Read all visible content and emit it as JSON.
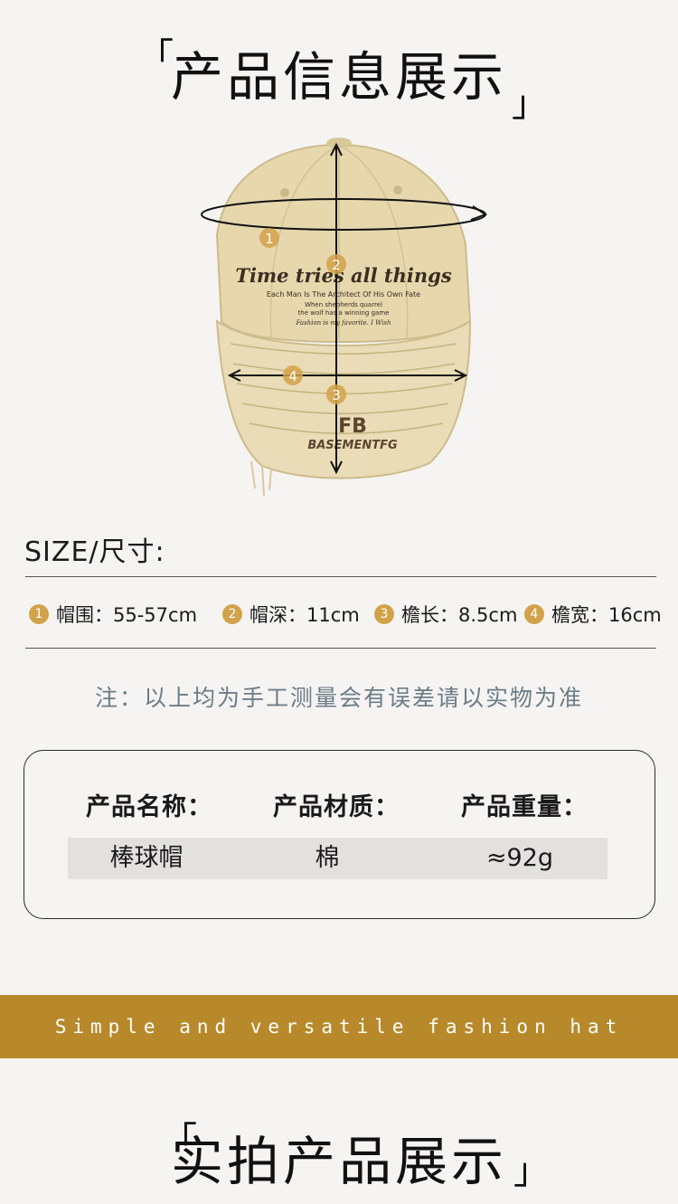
{
  "section1": {
    "title": "产品信息展示",
    "open_bracket": "「",
    "close_bracket": "」"
  },
  "hat": {
    "script_text": "Time tries all things",
    "subline1": "Each Man Is The Architect Of His Own Fate",
    "subline2": "When shepherds quarrel",
    "subline3": "the wolf has a winning game",
    "subline4": "Fashion is my favorite. I Wish",
    "logo_text": "BASEMENTFG",
    "markers": [
      "1",
      "2",
      "3",
      "4"
    ],
    "color": "#e6d7ad"
  },
  "size": {
    "label": "SIZE/尺寸:",
    "items": [
      {
        "num": "1",
        "text": "帽围：55-57cm"
      },
      {
        "num": "2",
        "text": "帽深：11cm"
      },
      {
        "num": "3",
        "text": "檐长：8.5cm"
      },
      {
        "num": "4",
        "text": "檐宽：16cm"
      }
    ]
  },
  "note": "注：以上均为手工测量会有误差请以实物为准",
  "info": {
    "headers": [
      "产品名称：",
      "产品材质：",
      "产品重量："
    ],
    "values": [
      "棒球帽",
      "棉",
      "≈92g"
    ]
  },
  "banner": "Simple and versatile fashion hat",
  "section2": {
    "title": "实拍产品展示",
    "open_bracket": "「",
    "close_bracket": "」"
  },
  "colors": {
    "accent": "#d2a24a",
    "banner": "#b8892a",
    "note": "#6d7c87"
  }
}
